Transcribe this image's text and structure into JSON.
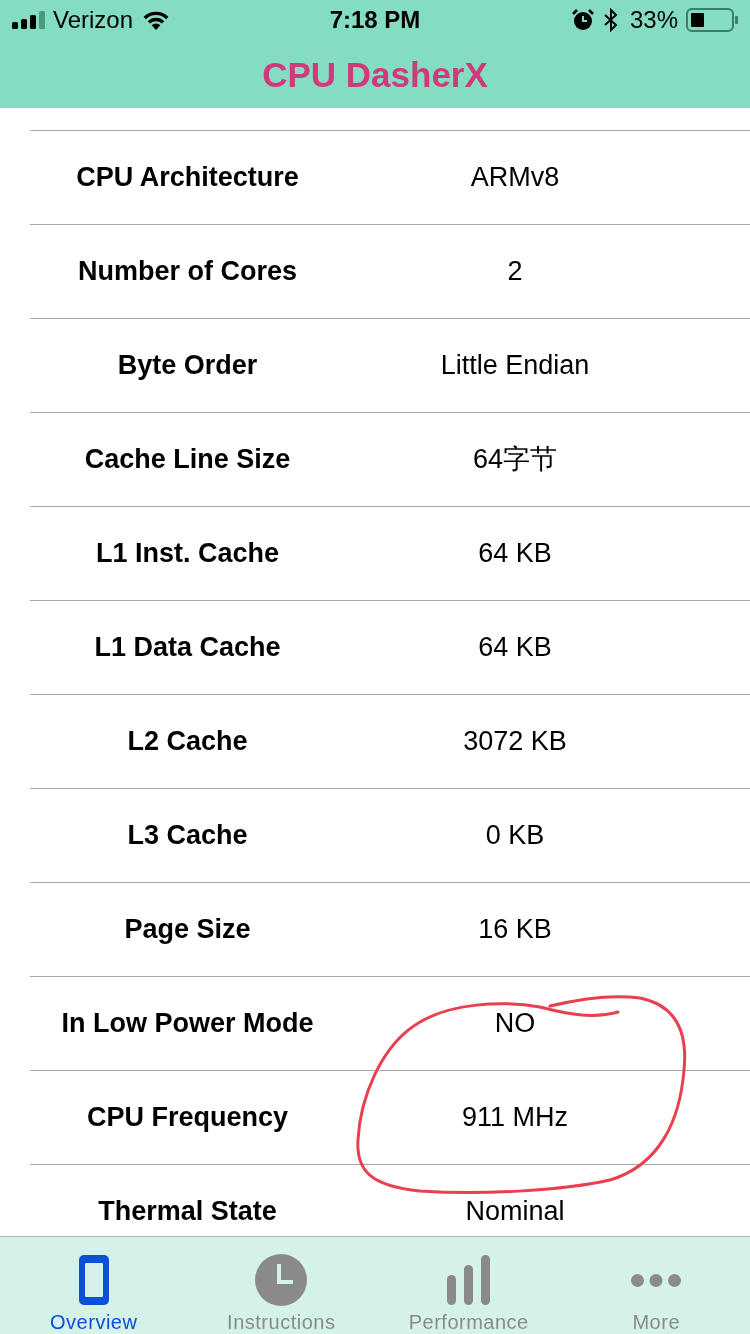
{
  "status_bar": {
    "carrier": "Verizon",
    "time": "7:18 PM",
    "battery": "33%"
  },
  "nav_bar": {
    "title": "CPU DasherX"
  },
  "rows": [
    {
      "label": "CPU Architecture",
      "value": "ARMv8"
    },
    {
      "label": "Number of Cores",
      "value": "2"
    },
    {
      "label": "Byte Order",
      "value": "Little Endian"
    },
    {
      "label": "Cache Line Size",
      "value": "64字节"
    },
    {
      "label": "L1 Inst. Cache",
      "value": "64 KB"
    },
    {
      "label": "L1 Data Cache",
      "value": "64 KB"
    },
    {
      "label": "L2 Cache",
      "value": "3072 KB"
    },
    {
      "label": "L3 Cache",
      "value": "0 KB"
    },
    {
      "label": "Page Size",
      "value": "16 KB"
    },
    {
      "label": "In Low Power Mode",
      "value": "NO"
    },
    {
      "label": "CPU Frequency",
      "value": "911 MHz"
    },
    {
      "label": "Thermal State",
      "value": "Nominal"
    }
  ],
  "tab_bar": {
    "tabs": [
      {
        "label": "Overview",
        "selected": true
      },
      {
        "label": "Instructions",
        "selected": false
      },
      {
        "label": "Performance",
        "selected": false
      },
      {
        "label": "More",
        "selected": false
      }
    ]
  }
}
